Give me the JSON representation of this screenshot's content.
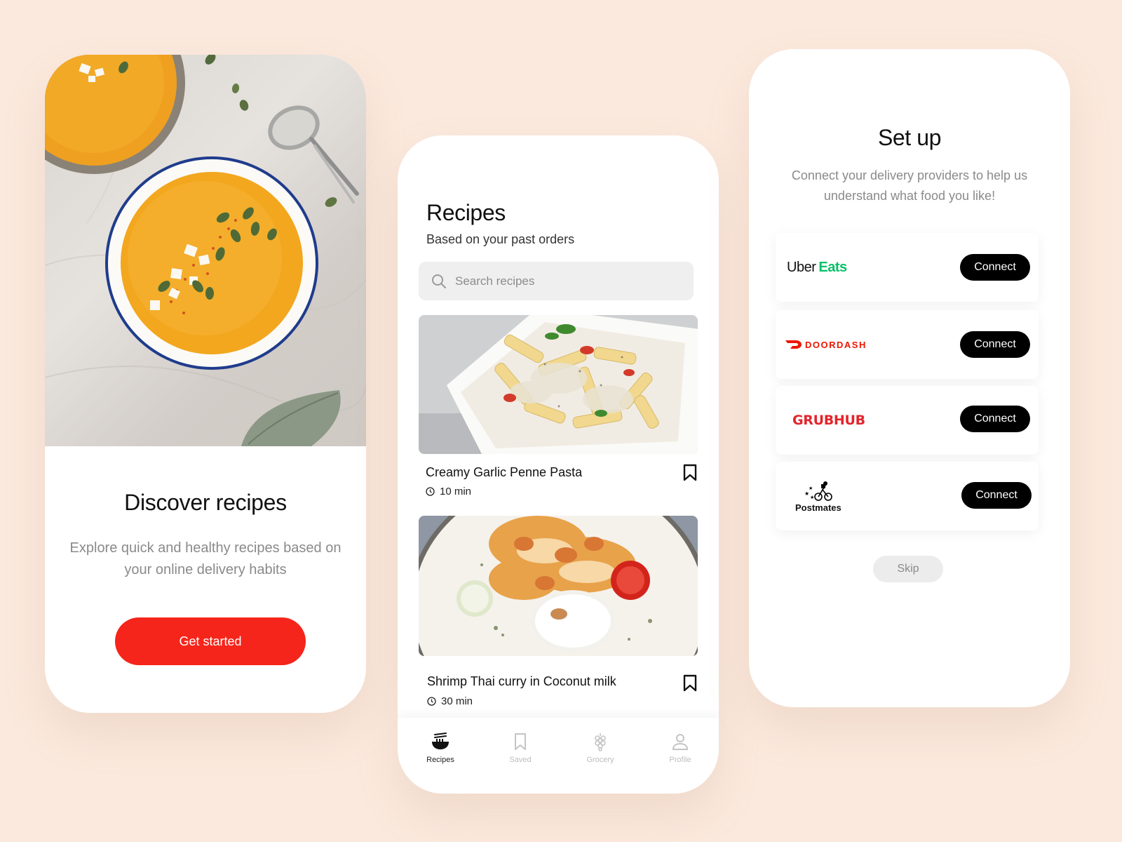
{
  "onboarding": {
    "title": "Discover recipes",
    "description": "Explore quick and healthy recipes based on your online delivery habits",
    "cta_label": "Get started",
    "accent_color": "#f5251b"
  },
  "recipes_screen": {
    "title": "Recipes",
    "subtitle": "Based on your past orders",
    "search": {
      "placeholder": "Search recipes"
    },
    "items": [
      {
        "name": "Creamy Garlic Penne Pasta",
        "time": "10 min",
        "icon": "bookmark-icon"
      },
      {
        "name": "Shrimp Thai curry in Coconut milk",
        "time": "30 min",
        "icon": "bookmark-icon"
      }
    ],
    "tabs": [
      {
        "label": "Recipes",
        "icon": "noodle-bowl-icon",
        "active": true
      },
      {
        "label": "Saved",
        "icon": "bookmark-icon",
        "active": false
      },
      {
        "label": "Grocery",
        "icon": "grapes-icon",
        "active": false
      },
      {
        "label": "Profile",
        "icon": "user-icon",
        "active": false
      }
    ]
  },
  "setup_screen": {
    "title": "Set up",
    "description": "Connect your delivery providers to help us understand what food you like!",
    "providers": [
      {
        "name_part1": "Uber",
        "name_part2": "Eats",
        "button": "Connect",
        "brand_color": "#06c167"
      },
      {
        "name": "DOORDASH",
        "button": "Connect",
        "brand_color": "#eb1700"
      },
      {
        "name": "GRUBHUB",
        "button": "Connect",
        "brand_color": "#e3242b"
      },
      {
        "name": "Postmates",
        "button": "Connect",
        "brand_color": "#000000"
      }
    ],
    "skip_label": "Skip"
  }
}
